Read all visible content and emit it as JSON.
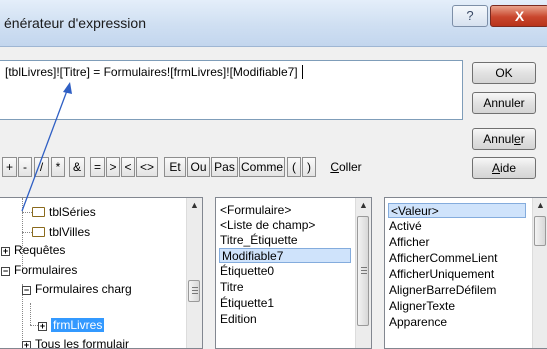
{
  "window": {
    "title": "énérateur d'expression",
    "help_glyph": "?",
    "close_glyph": "X"
  },
  "expression": {
    "text": "[tblLivres]![Titre] = Formulaires![frmLivres]![Modifiable7]"
  },
  "buttons": {
    "ok": "OK",
    "annuler": "Annuler",
    "annuler2_prefix": "Annul",
    "annuler2_u": "e",
    "annuler2_suffix": "r",
    "aide_u": "A",
    "aide_rest": "ide",
    "coller_u": "C",
    "coller_rest": "oller"
  },
  "operators": [
    "+",
    "-",
    "/",
    "*",
    "&",
    "=",
    ">",
    "<",
    "<>",
    "Et",
    "Ou",
    "Pas",
    "Comme",
    "(",
    ")"
  ],
  "tree": {
    "items": [
      {
        "label": "tblSéries"
      },
      {
        "label": "tblVilles"
      },
      {
        "label": "Requêtes",
        "expander": "+"
      },
      {
        "label": "Formulaires",
        "expander": "−"
      },
      {
        "label": "Formulaires charg",
        "expander": "−"
      },
      {
        "label": "frmLivres",
        "expander": "+"
      },
      {
        "label": "Tous les formulair",
        "expander": "+"
      }
    ]
  },
  "middle_list": {
    "items": [
      "<Formulaire>",
      "<Liste de champ>",
      "Titre_Étiquette",
      "Modifiable7",
      "Étiquette0",
      "Titre",
      "Étiquette1",
      "Edition"
    ],
    "selected_index": 3
  },
  "right_list": {
    "items": [
      "<Valeur>",
      "Activé",
      "Afficher",
      "AfficherCommeLient",
      "AfficherUniquement",
      "AlignerBarreDéfilem",
      "AlignerTexte",
      "Apparence"
    ],
    "selected_index": 0
  },
  "colors": {
    "selection": "#cfe3fb",
    "tree_highlight": "#3399ff",
    "annotation_arrow": "#2f5fc4"
  }
}
